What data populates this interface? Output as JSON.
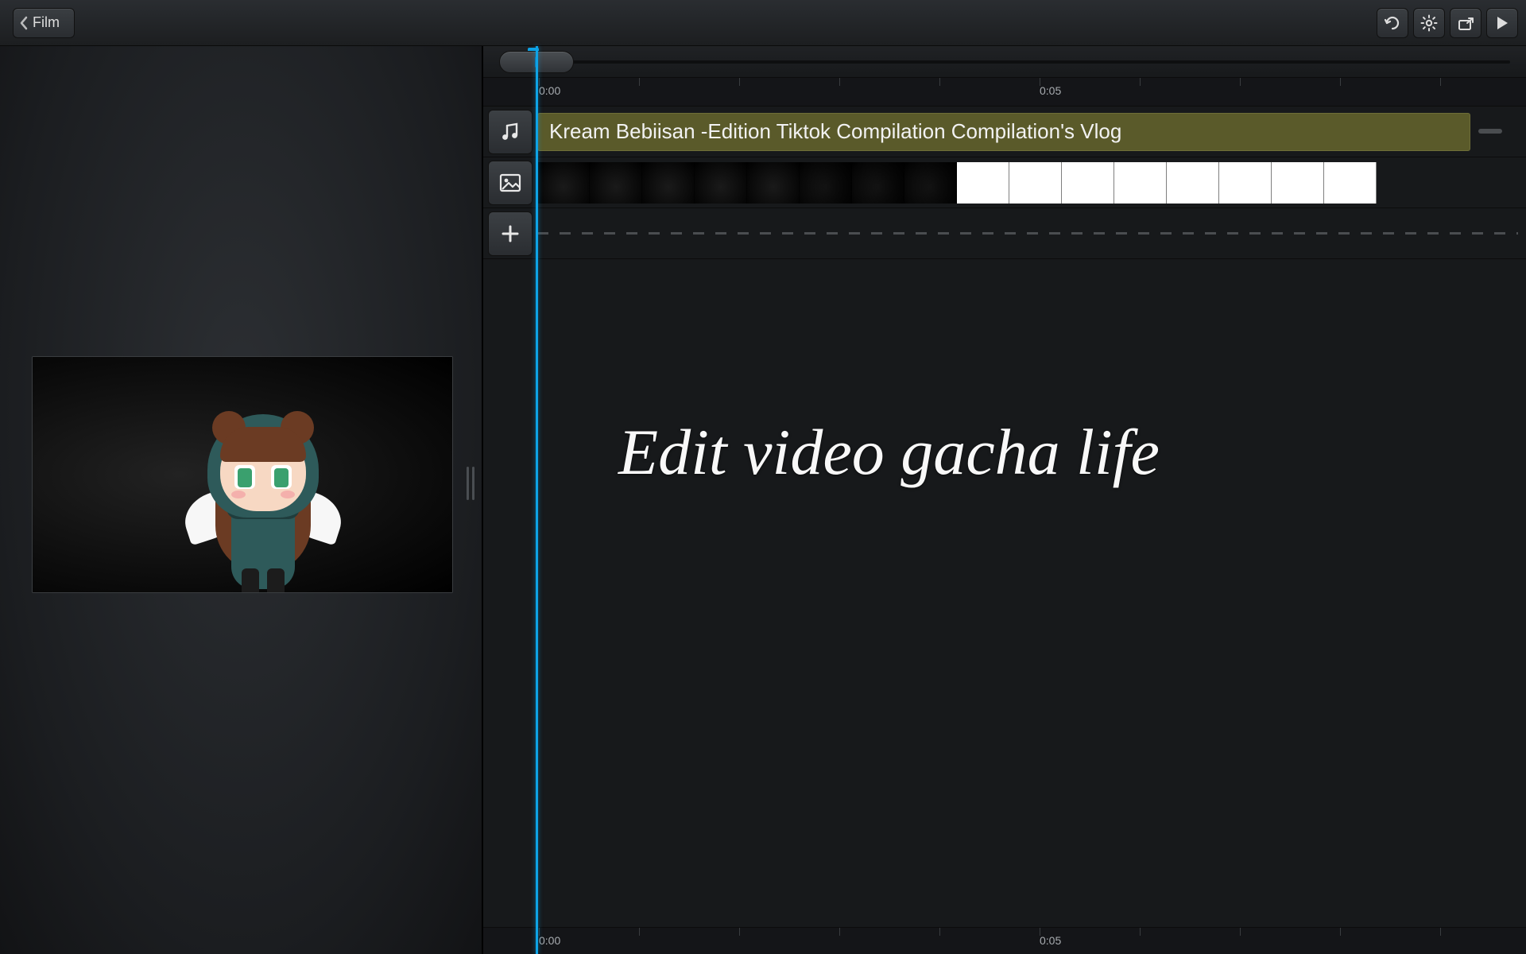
{
  "toolbar": {
    "back_label": "Film"
  },
  "timeline": {
    "time_labels": [
      "0:00",
      "0:05"
    ],
    "audio_clip_title": "Kream Bebiisan -Edition Tiktok Compilation Compilation's Vlog"
  },
  "overlay": {
    "text": "Edit video gacha life"
  },
  "icons": {
    "undo": "undo-icon",
    "settings": "gear-icon",
    "share": "share-icon",
    "play": "play-icon",
    "music": "music-icon",
    "image": "image-icon",
    "plus": "plus-icon"
  }
}
